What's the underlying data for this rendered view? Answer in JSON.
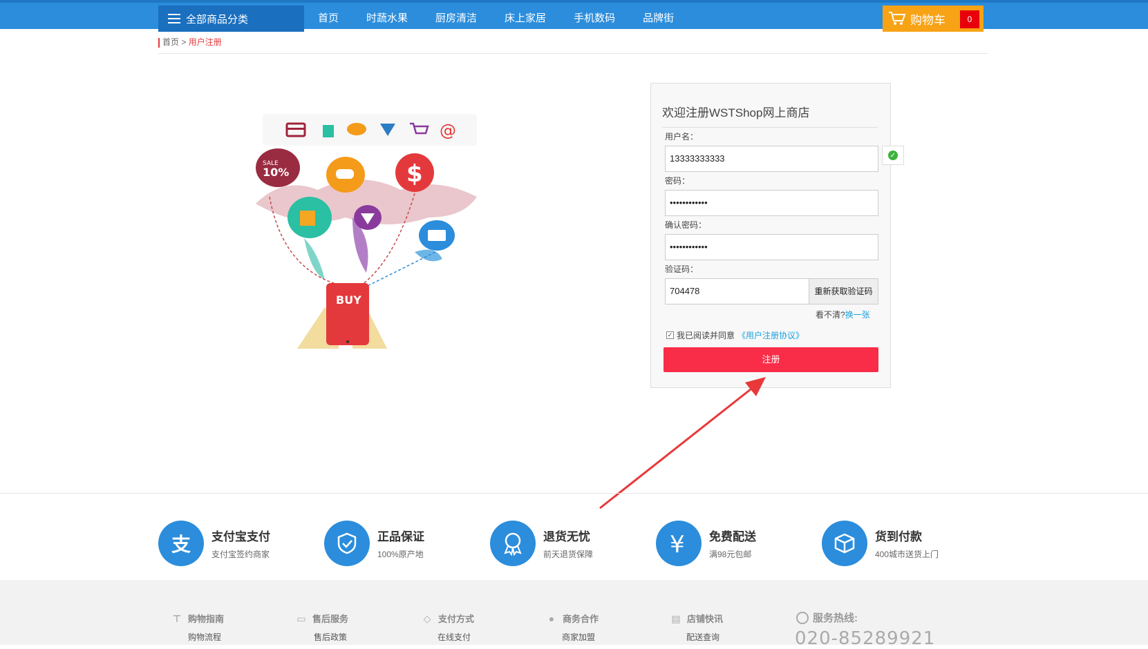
{
  "header": {
    "category_label": "全部商品分类",
    "nav": [
      "首页",
      "时蔬水果",
      "厨房清洁",
      "床上家居",
      "手机数码",
      "品牌街"
    ],
    "cart_label": "购物车",
    "cart_count": "0"
  },
  "breadcrumb": {
    "home": "首页",
    "sep": ">",
    "current": "用户注册"
  },
  "illustration": {
    "icons": [
      "card-icon",
      "bag-icon",
      "chat-icon",
      "diamond-icon",
      "cart-icon",
      "at-icon"
    ],
    "sale_text": "SALE",
    "sale_pct": "10%",
    "buy_text": "BUY"
  },
  "form": {
    "title": "欢迎注册WSTShop网上商店",
    "username_label": "用户名：",
    "username_value": "13333333333",
    "password_label": "密码：",
    "password_value": "••••••••••••",
    "confirm_label": "确认密码：",
    "confirm_value": "••••••••••••",
    "code_label": "验证码：",
    "code_value": "704478",
    "code_button": "重新获取验证码",
    "refresh_prefix": "看不清?",
    "refresh_link": "换一张",
    "agree_text": "我已阅读并同意",
    "agree_link": "《用户注册协议》",
    "submit_label": "注册"
  },
  "services": [
    {
      "title": "支付宝支付",
      "sub": "支付宝签约商家",
      "icon": "alipay-icon"
    },
    {
      "title": "正品保证",
      "sub": "100%原产地",
      "icon": "shield-icon"
    },
    {
      "title": "退货无忧",
      "sub": "前天退货保障",
      "icon": "badge-icon"
    },
    {
      "title": "免费配送",
      "sub": "满98元包邮",
      "icon": "yen-icon"
    },
    {
      "title": "货到付款",
      "sub": "400城市送货上门",
      "icon": "box-icon"
    }
  ],
  "footer": {
    "columns": [
      {
        "title": "购物指南",
        "item": "购物流程"
      },
      {
        "title": "售后服务",
        "item": "售后政策"
      },
      {
        "title": "支付方式",
        "item": "在线支付"
      },
      {
        "title": "商务合作",
        "item": "商家加盟"
      },
      {
        "title": "店铺快讯",
        "item": "配送查询"
      }
    ],
    "hotline_label": "服务热线:",
    "hotline_number": "020-85289921"
  },
  "colors": {
    "brand_blue": "#2b8ddc",
    "cart_orange": "#f7a315",
    "submit_red": "#fa2d48",
    "link_blue": "#1a9fe0"
  }
}
